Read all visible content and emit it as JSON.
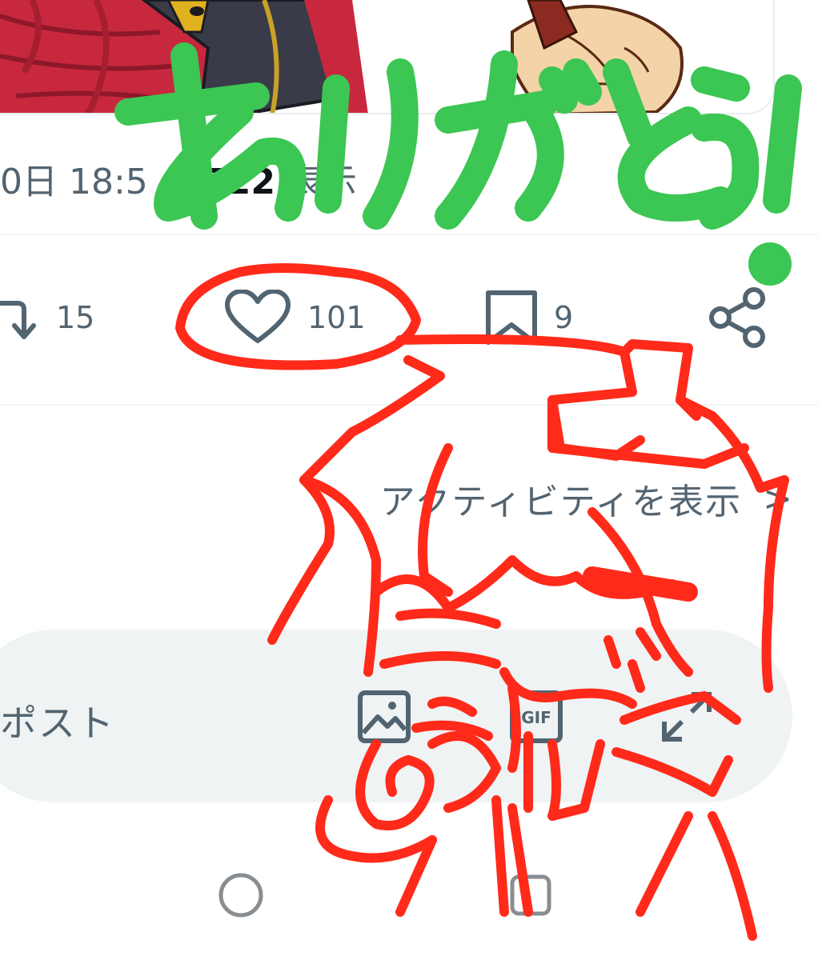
{
  "post": {
    "timestamp_fragment": "0日 18:5",
    "view_count": "1,522",
    "view_suffix": "表示",
    "actions": {
      "repost_count": "15",
      "like_count": "101",
      "bookmark_count": "9"
    },
    "activity_link": "アクティビティを表示",
    "activity_chevron": ">"
  },
  "reply": {
    "placeholder": "ポスト"
  },
  "overlay": {
    "message": "ありがとう!",
    "message_color": "#3cc653",
    "doodle_color": "#ff2a1a"
  },
  "icons": {
    "repost": "repost-icon",
    "like": "heart-icon",
    "bookmark": "bookmark-icon",
    "share": "share-icon",
    "image": "image-icon",
    "gif": "gif-icon",
    "expand": "expand-icon",
    "home": "home-circle-icon",
    "recents": "recents-square-icon"
  },
  "colors": {
    "text_secondary": "#536471",
    "text_primary": "#0f1419",
    "reply_bg": "#eff3f4"
  }
}
